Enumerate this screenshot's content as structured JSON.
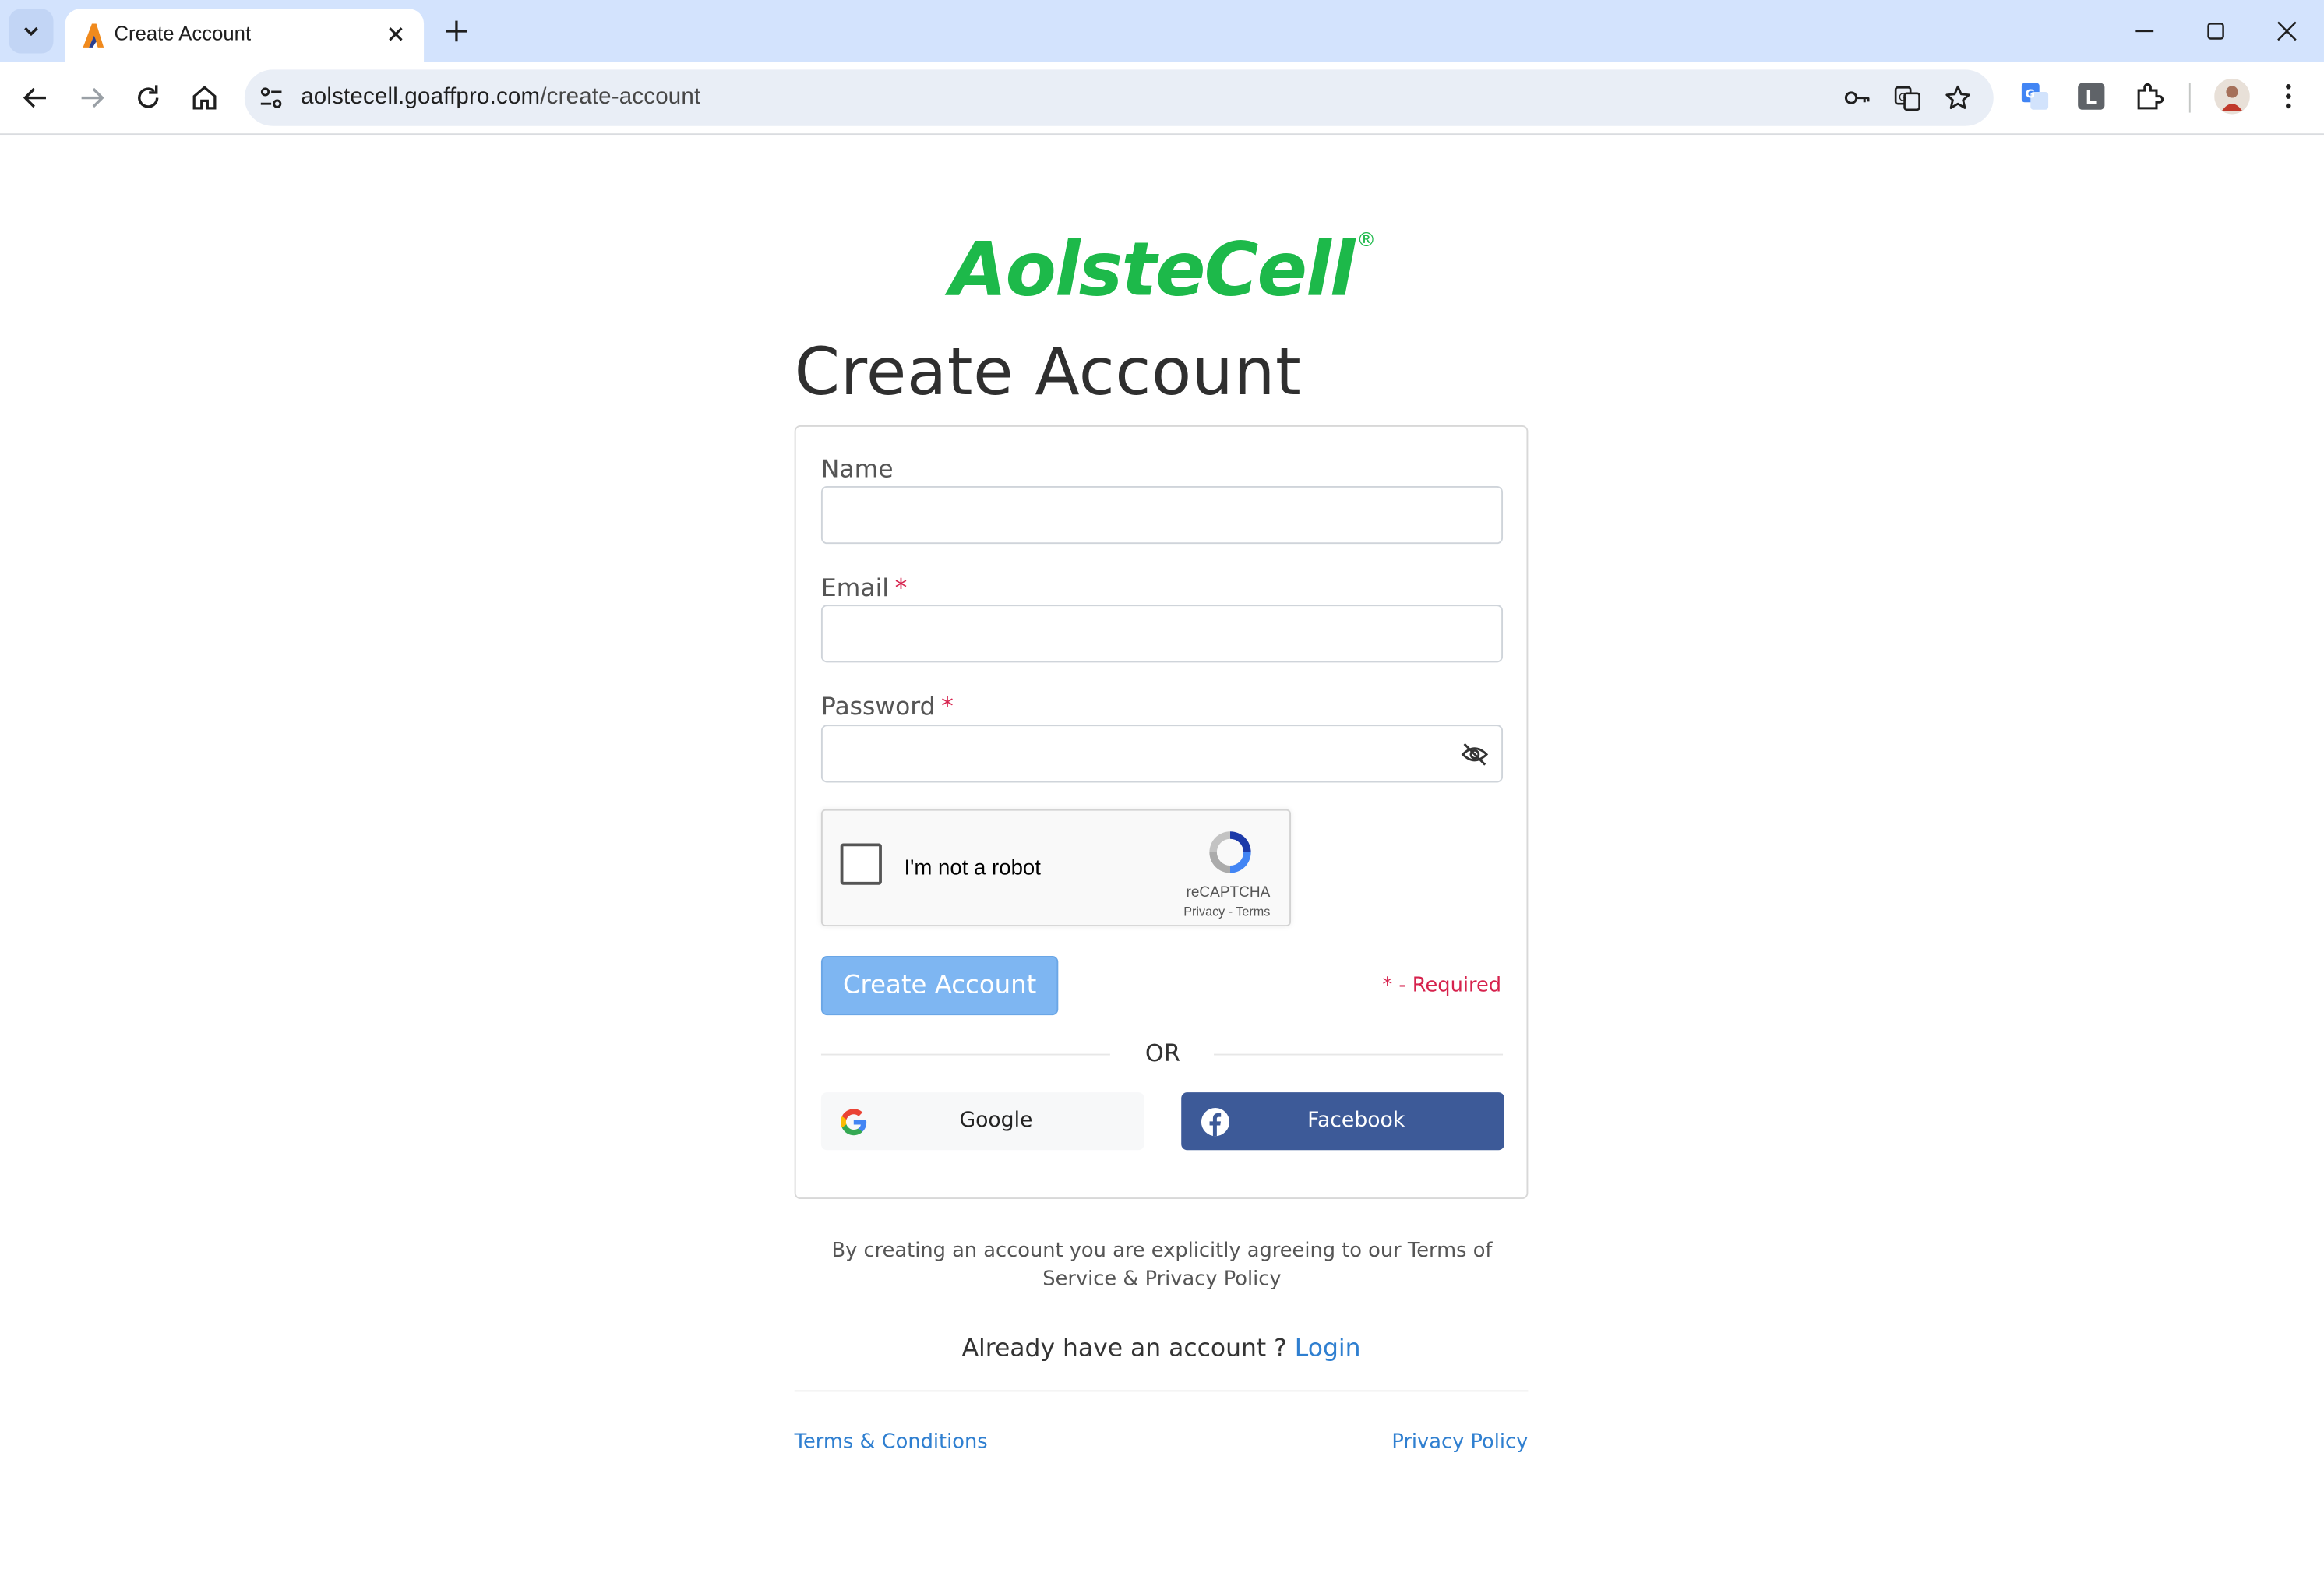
{
  "browser": {
    "tab_title": "Create Account",
    "url_host": "aolstecell.goaffpro.com",
    "url_path": "/create-account"
  },
  "page": {
    "logo_text": "AolsteCell",
    "logo_mark": "®",
    "heading": "Create Account",
    "form": {
      "name_label": "Name",
      "email_label": "Email",
      "password_label": "Password",
      "required_marker": "*",
      "name_value": "",
      "email_value": "",
      "password_value": ""
    },
    "captcha": {
      "label": "I'm not a robot",
      "brand": "reCAPTCHA",
      "links": "Privacy - Terms"
    },
    "submit_label": "Create Account",
    "required_note": "* - Required",
    "or_label": "OR",
    "google_label": "Google",
    "facebook_label": "Facebook",
    "agreement": "By creating an account you are explicitly agreeing to our Terms of Service & Privacy Policy",
    "already_text": "Already have an account ?",
    "login_label": "Login",
    "footer": {
      "terms": "Terms & Conditions",
      "privacy": "Privacy Policy"
    }
  },
  "colors": {
    "brand_green": "#1db94a",
    "primary_button": "#7eb6f2",
    "facebook": "#3d5a98",
    "required": "#d6224d",
    "link": "#2f7fd0"
  }
}
